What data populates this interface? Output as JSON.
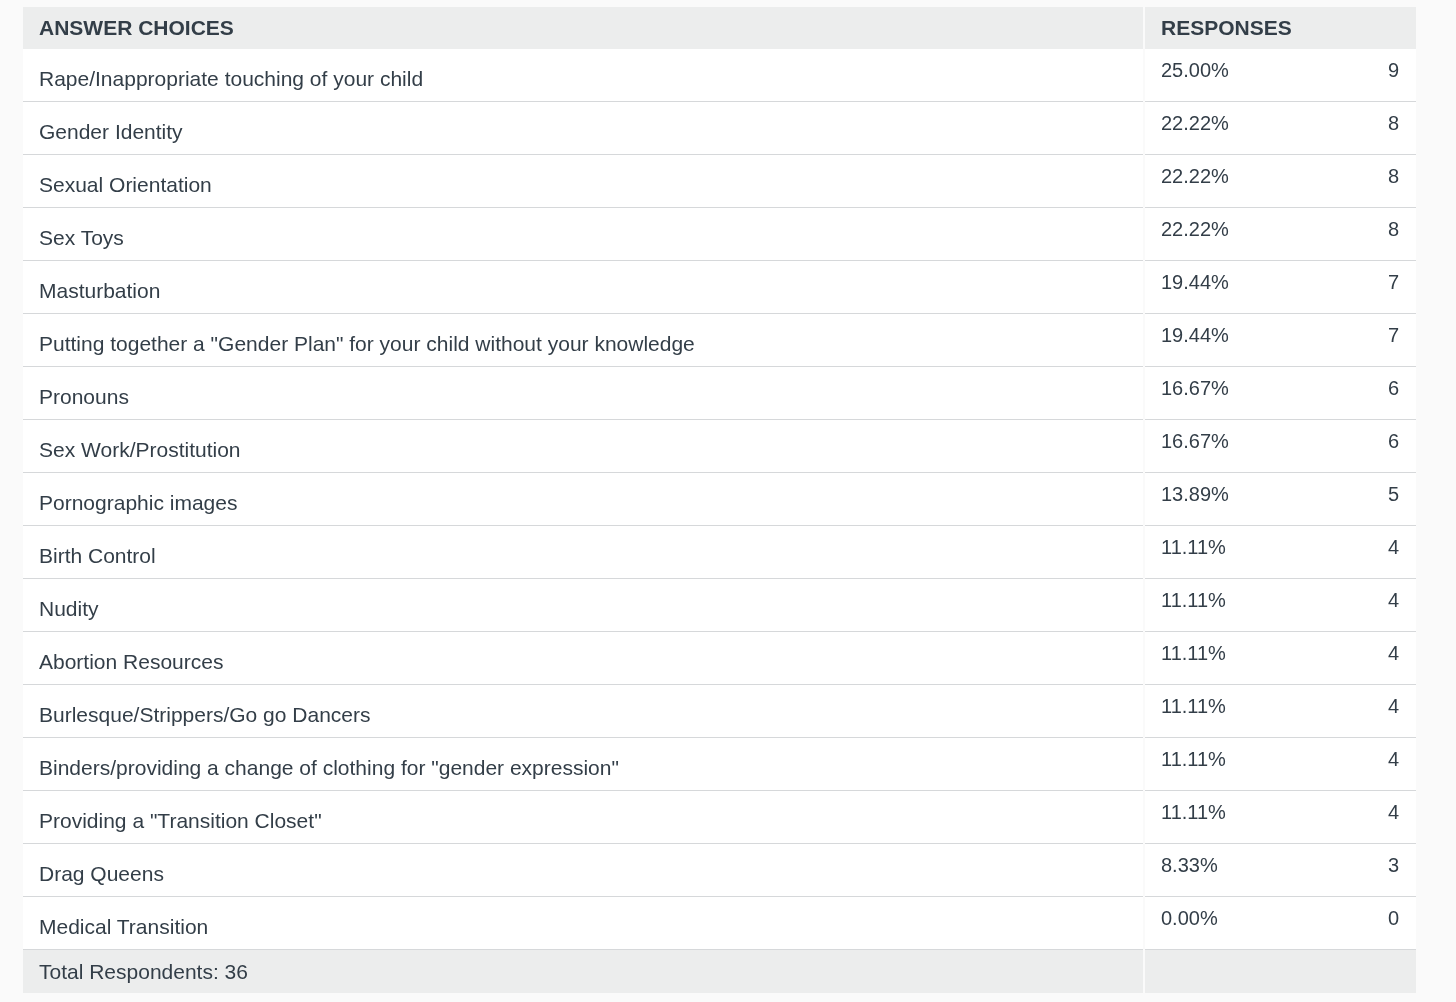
{
  "table": {
    "columns": [
      "ANSWER CHOICES",
      "RESPONSES"
    ],
    "rows": [
      {
        "choice": "Rape/Inappropriate touching of your child",
        "percent": "25.00%",
        "count": "9"
      },
      {
        "choice": "Gender Identity",
        "percent": "22.22%",
        "count": "8"
      },
      {
        "choice": "Sexual Orientation",
        "percent": "22.22%",
        "count": "8"
      },
      {
        "choice": "Sex Toys",
        "percent": "22.22%",
        "count": "8"
      },
      {
        "choice": "Masturbation",
        "percent": "19.44%",
        "count": "7"
      },
      {
        "choice": "Putting together a \"Gender Plan\" for your child without your knowledge",
        "percent": "19.44%",
        "count": "7"
      },
      {
        "choice": "Pronouns",
        "percent": "16.67%",
        "count": "6"
      },
      {
        "choice": "Sex Work/Prostitution",
        "percent": "16.67%",
        "count": "6"
      },
      {
        "choice": "Pornographic images",
        "percent": "13.89%",
        "count": "5"
      },
      {
        "choice": "Birth Control",
        "percent": "11.11%",
        "count": "4"
      },
      {
        "choice": "Nudity",
        "percent": "11.11%",
        "count": "4"
      },
      {
        "choice": "Abortion Resources",
        "percent": "11.11%",
        "count": "4"
      },
      {
        "choice": "Burlesque/Strippers/Go go Dancers",
        "percent": "11.11%",
        "count": "4"
      },
      {
        "choice": "Binders/providing a change of clothing for \"gender expression\"",
        "percent": "11.11%",
        "count": "4"
      },
      {
        "choice": "Providing a \"Transition Closet\"",
        "percent": "11.11%",
        "count": "4"
      },
      {
        "choice": "Drag Queens",
        "percent": "8.33%",
        "count": "3"
      },
      {
        "choice": "Medical Transition",
        "percent": "0.00%",
        "count": "0"
      }
    ],
    "footer": "Total Respondents: 36"
  }
}
